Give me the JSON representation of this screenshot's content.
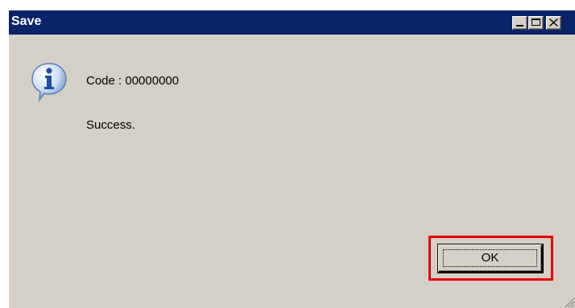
{
  "window": {
    "title": "Save",
    "titlebar_color": "#0a246a",
    "body_color": "#d4d0c8",
    "controls": [
      "minimize-icon",
      "maximize-icon",
      "close-icon"
    ]
  },
  "message": {
    "icon": "info-icon",
    "code_line": "Code : 00000000",
    "body_line": "Success."
  },
  "buttons": {
    "ok_label": "OK",
    "highlight_color": "#e60000"
  }
}
